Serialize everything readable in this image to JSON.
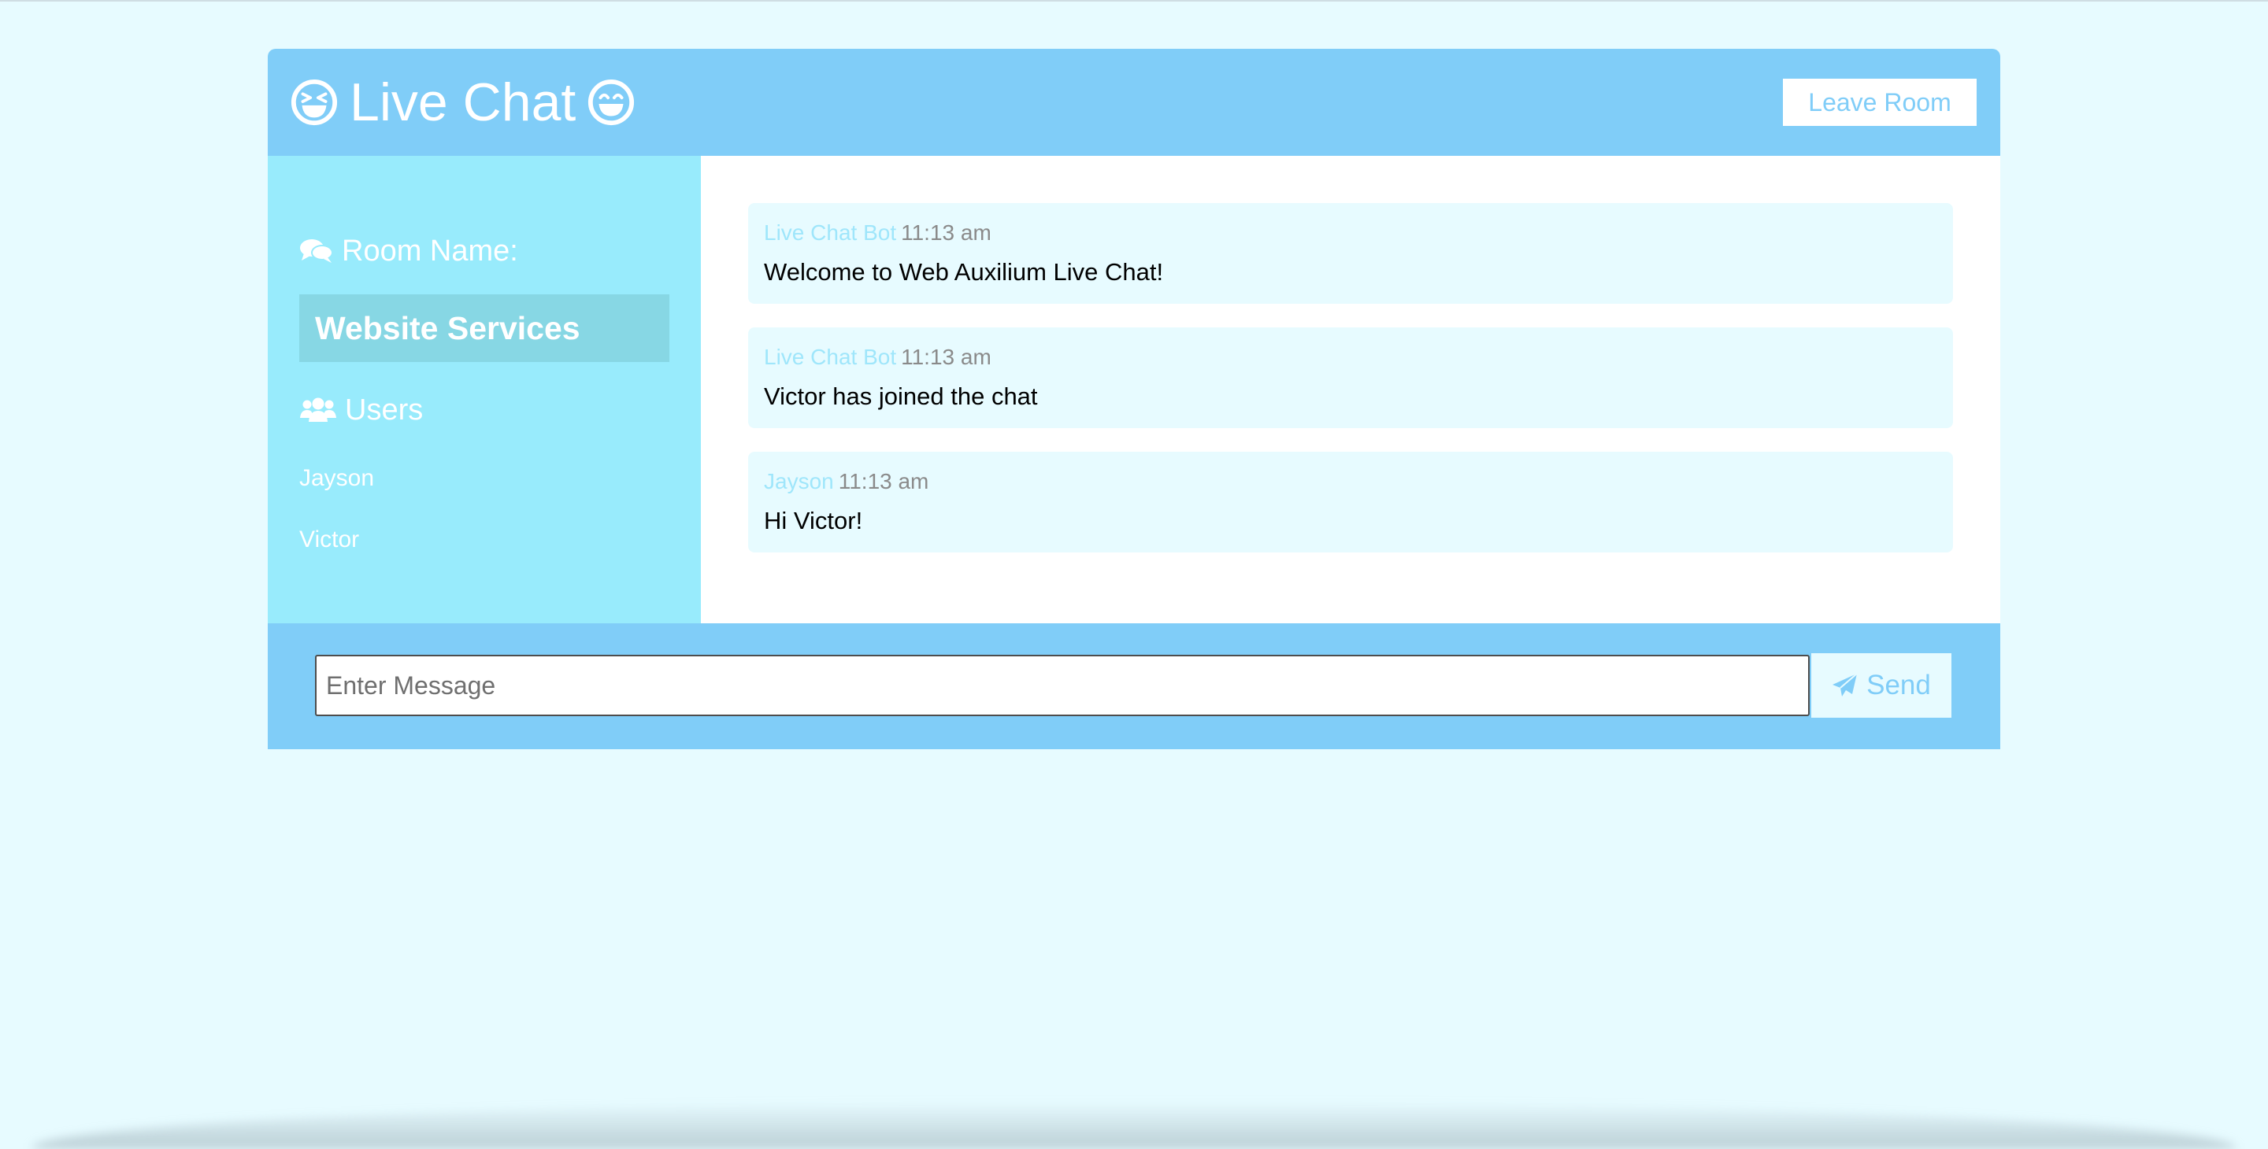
{
  "header": {
    "title": "Live Chat",
    "left_emoji_icon": "laughing-face-icon",
    "right_emoji_icon": "grinning-face-icon",
    "leave_label": "Leave Room"
  },
  "sidebar": {
    "room_heading": "Room Name:",
    "room_icon": "comments-icon",
    "room_name": "Website Services",
    "users_heading": "Users",
    "users_icon": "users-icon",
    "users": [
      "Jayson",
      "Victor"
    ]
  },
  "messages": [
    {
      "author": "Live Chat Bot",
      "time": "11:13 am",
      "text": "Welcome to Web Auxilium Live Chat!"
    },
    {
      "author": "Live Chat Bot",
      "time": "11:13 am",
      "text": "Victor has joined the chat"
    },
    {
      "author": "Jayson",
      "time": "11:13 am",
      "text": "Hi Victor!"
    }
  ],
  "form": {
    "placeholder": "Enter Message",
    "value": "",
    "send_label": "Send",
    "send_icon": "paper-plane-icon"
  },
  "colors": {
    "background": "#e7fbff",
    "primary": "#80cdf8",
    "sidebar": "#98ebfc",
    "room_name_bg": "#87d7e4",
    "author_name": "#9fe6fb"
  }
}
